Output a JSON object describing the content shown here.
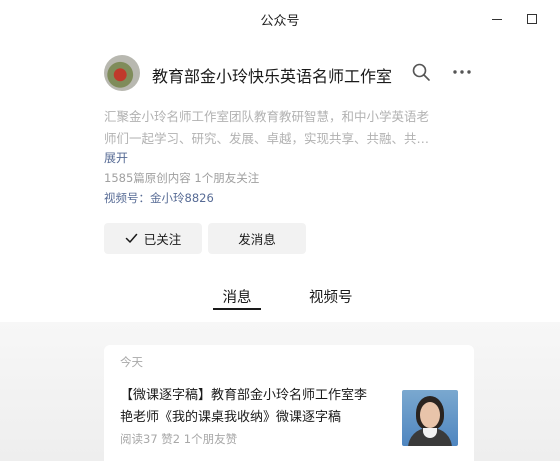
{
  "window": {
    "title": "公众号"
  },
  "account": {
    "name": "教育部金小玲快乐英语名师工作室",
    "description_lines": [
      "汇聚金小玲名师工作室团队教育教研智慧，和中小学英语老",
      "师们一起学习、研究、发展、卓越，实现共享、共融、共…"
    ],
    "expand_label": "展开",
    "stats": "1585篇原创内容  1个朋友关注",
    "channel": "视频号：金小玲8826"
  },
  "actions": {
    "follow_label": "已关注",
    "message_label": "发消息"
  },
  "tabs": [
    {
      "label": "消息",
      "active": true
    },
    {
      "label": "视频号",
      "active": false
    }
  ],
  "feed": {
    "day_label": "今天",
    "article": {
      "title_lines": [
        "【微课逐字稿】教育部金小玲名师工作室李",
        "艳老师《我的课桌我收纳》微课逐字稿"
      ],
      "meta": "阅读37  赞2  1个朋友赞"
    }
  },
  "icons": {
    "search": "search-icon",
    "more": "more-icon",
    "check": "check-icon",
    "minimize": "minimize-icon",
    "maximize": "maximize-icon"
  }
}
